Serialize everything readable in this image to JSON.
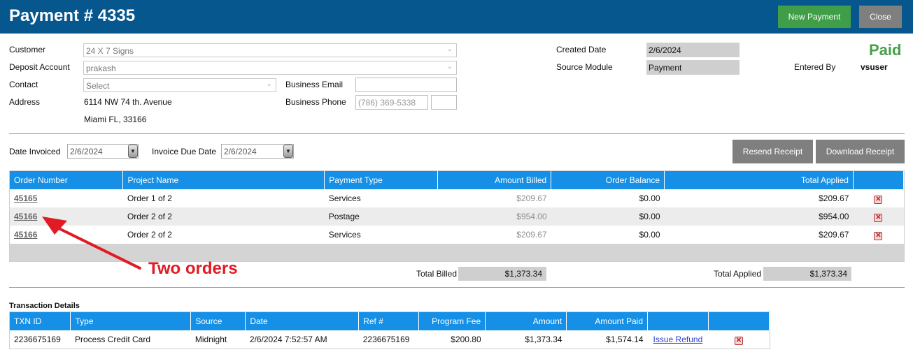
{
  "header": {
    "title": "Payment # 4335",
    "new_payment_label": "New Payment",
    "close_label": "Close"
  },
  "form": {
    "customer_label": "Customer",
    "customer_value": "24 X 7 Signs",
    "deposit_label": "Deposit Account",
    "deposit_value": "prakash",
    "contact_label": "Contact",
    "contact_value": "Select",
    "address_label": "Address",
    "address_line1": "6114 NW 74 th. Avenue",
    "address_line2": "Miami FL, 33166",
    "business_email_label": "Business Email",
    "business_email_value": "",
    "business_phone_label": "Business Phone",
    "business_phone_placeholder": "(786) 369-5338",
    "phone_ext_value": "",
    "created_date_label": "Created Date",
    "created_date_value": "2/6/2024",
    "source_module_label": "Source Module",
    "source_module_value": "Payment",
    "status": "Paid",
    "entered_by_label": "Entered By",
    "entered_by_value": "vsuser"
  },
  "dates": {
    "invoiced_label": "Date Invoiced",
    "invoiced_value": "2/6/2024",
    "due_label": "Invoice Due Date",
    "due_value": "2/6/2024",
    "resend_label": "Resend Receipt",
    "download_label": "Download Receipt"
  },
  "orders": {
    "headers": [
      "Order Number",
      "Project Name",
      "Payment Type",
      "Amount Billed",
      "Order Balance",
      "Total Applied"
    ],
    "rows": [
      {
        "order": "45165",
        "project": "Order 1 of 2",
        "type": "Services",
        "billed": "$209.67",
        "balance": "$0.00",
        "applied": "$209.67"
      },
      {
        "order": "45166",
        "project": "Order 2 of 2",
        "type": "Postage",
        "billed": "$954.00",
        "balance": "$0.00",
        "applied": "$954.00"
      },
      {
        "order": "45166",
        "project": "Order 2 of 2",
        "type": "Services",
        "billed": "$209.67",
        "balance": "$0.00",
        "applied": "$209.67"
      }
    ],
    "total_billed_label": "Total Billed",
    "total_billed_value": "$1,373.34",
    "total_applied_label": "Total Applied",
    "total_applied_value": "$1,373.34"
  },
  "annotation": {
    "text": "Two orders",
    "color": "#e01b24"
  },
  "transactions": {
    "title": "Transaction Details",
    "headers": [
      "TXN ID",
      "Type",
      "Source",
      "Date",
      "Ref #",
      "Program Fee",
      "Amount",
      "Amount Paid"
    ],
    "rows": [
      {
        "txn": "2236675169",
        "type": "Process Credit Card",
        "source": "Midnight",
        "date": "2/6/2024 7:52:57 AM",
        "ref": "2236675169",
        "fee": "$200.80",
        "amount": "$1,373.34",
        "paid": "$1,574.14",
        "action": "Issue Refund"
      }
    ]
  },
  "colors": {
    "header_bg": "#07578f",
    "table_header_bg": "#1590e6",
    "paid_green": "#45a049",
    "new_payment_green": "#3f9e47"
  },
  "icons": {
    "dropdown": "chevron-down-icon",
    "date_picker": "calendar-dropdown-icon",
    "delete": "delete-x-icon"
  }
}
